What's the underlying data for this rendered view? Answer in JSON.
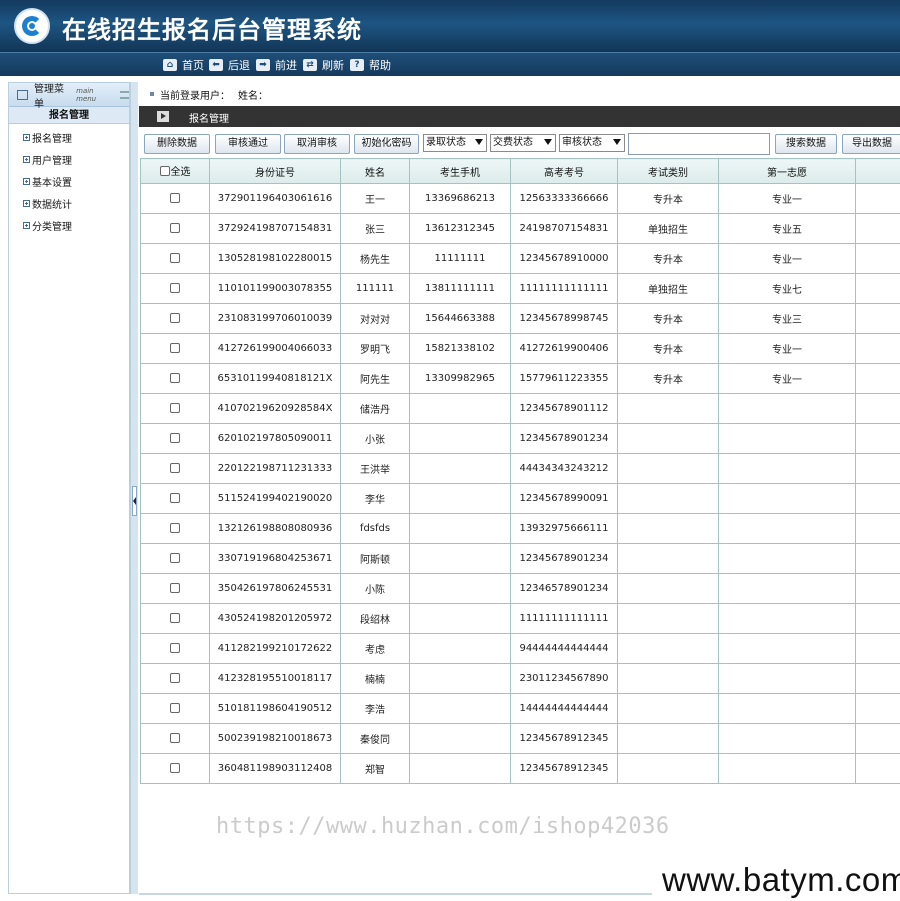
{
  "header": {
    "title": "在线招生报名后台管理系统"
  },
  "nav": {
    "items": [
      {
        "icon": "home-icon",
        "glyph": "⌂",
        "label": "首页"
      },
      {
        "icon": "back-arrow-icon",
        "glyph": "⬅",
        "label": "后退"
      },
      {
        "icon": "forward-arrow-icon",
        "glyph": "➡",
        "label": "前进"
      },
      {
        "icon": "refresh-icon",
        "glyph": "⇄",
        "label": "刷新"
      },
      {
        "icon": "help-icon",
        "glyph": "?",
        "label": "帮助"
      }
    ]
  },
  "sidebar": {
    "title": "管理菜单",
    "subtitle": "main menu",
    "current": "报名管理",
    "items": [
      {
        "label": "报名管理"
      },
      {
        "label": "用户管理"
      },
      {
        "label": "基本设置"
      },
      {
        "label": "数据统计"
      },
      {
        "label": "分类管理"
      }
    ]
  },
  "welcome": {
    "user_label": "当前登录用户：",
    "name_label": "姓名："
  },
  "section": {
    "title": "报名管理"
  },
  "toolbar": {
    "delete": "删除数据",
    "approve": "审核通过",
    "cancel_approve": "取消审核",
    "reset_password": "初始化密码",
    "admission_status": "录取状态",
    "fee_status": "交费状态",
    "review_status": "审核状态",
    "search_value": "",
    "search": "搜索数据",
    "export": "导出数据"
  },
  "table": {
    "select_all": "全选",
    "columns": [
      "身份证号",
      "姓名",
      "考生手机",
      "高考考号",
      "考试类别",
      "第一志愿"
    ],
    "rows": [
      [
        "372901196403061616",
        "王一",
        "13369686213",
        "12563333366666",
        "专升本",
        "专业一"
      ],
      [
        "372924198707154831",
        "张三",
        "13612312345",
        "24198707154831",
        "单独招生",
        "专业五"
      ],
      [
        "130528198102280015",
        "杨先生",
        "11111111",
        "12345678910000",
        "专升本",
        "专业一"
      ],
      [
        "110101199003078355",
        "111111",
        "13811111111",
        "11111111111111",
        "单独招生",
        "专业七"
      ],
      [
        "231083199706010039",
        "对对对",
        "15644663388",
        "12345678998745",
        "专升本",
        "专业三"
      ],
      [
        "412726199004066033",
        "罗明飞",
        "15821338102",
        "41272619900406",
        "专升本",
        "专业一"
      ],
      [
        "65310119940818121X",
        "阿先生",
        "13309982965",
        "15779611223355",
        "专升本",
        "专业一"
      ],
      [
        "41070219620928584X",
        "储浩丹",
        "",
        "12345678901112",
        "",
        ""
      ],
      [
        "620102197805090011",
        "小张",
        "",
        "12345678901234",
        "",
        ""
      ],
      [
        "220122198711231333",
        "王洪举",
        "",
        "44434343243212",
        "",
        ""
      ],
      [
        "511524199402190020",
        "李华",
        "",
        "12345678990091",
        "",
        ""
      ],
      [
        "132126198808080936",
        "fdsfds",
        "",
        "13932975666111",
        "",
        ""
      ],
      [
        "330719196804253671",
        "阿斯顿",
        "",
        "12345678901234",
        "",
        ""
      ],
      [
        "350426197806245531",
        "小陈",
        "",
        "12346578901234",
        "",
        ""
      ],
      [
        "430524198201205972",
        "段绍林",
        "",
        "11111111111111",
        "",
        ""
      ],
      [
        "411282199210172622",
        "考虑",
        "",
        "94444444444444",
        "",
        ""
      ],
      [
        "412328195510018117",
        "楠楠",
        "",
        "23011234567890",
        "",
        ""
      ],
      [
        "510181198604190512",
        "李浩",
        "",
        "14444444444444",
        "",
        ""
      ],
      [
        "500239198210018673",
        "秦俊同",
        "",
        "12345678912345",
        "",
        ""
      ],
      [
        "360481198903112408",
        "郑智",
        "",
        "12345678912345",
        "",
        ""
      ]
    ]
  },
  "watermark": "https://www.huzhan.com/ishop42036",
  "brand": "www.batym.com"
}
